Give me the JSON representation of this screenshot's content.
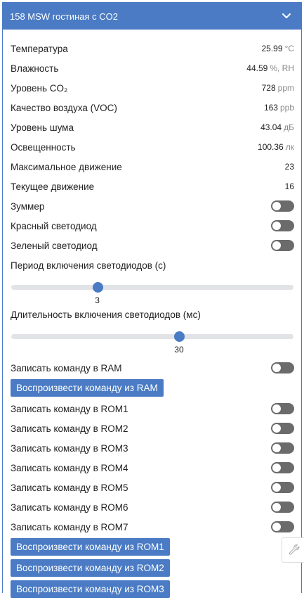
{
  "header": {
    "title": "158 MSW гостиная с CO2"
  },
  "sensors": [
    {
      "label": "Температура",
      "value": "25.99",
      "unit": "°C"
    },
    {
      "label": "Влажность",
      "value": "44.59",
      "unit": "%, RH"
    },
    {
      "label": "Уровень CO₂",
      "value": "728",
      "unit": "ppm"
    },
    {
      "label": "Качество воздуха (VOC)",
      "value": "163",
      "unit": "ppb"
    },
    {
      "label": "Уровень шума",
      "value": "43.04",
      "unit": "дБ"
    },
    {
      "label": "Освещенность",
      "value": "100.36",
      "unit": "лк"
    },
    {
      "label": "Максимальное движение",
      "value": "23",
      "unit": ""
    },
    {
      "label": "Текущее движение",
      "value": "16",
      "unit": ""
    }
  ],
  "switches": [
    {
      "label": "Зуммер",
      "on": false
    },
    {
      "label": "Красный светодиод",
      "on": false
    },
    {
      "label": "Зеленый светодиод",
      "on": false
    }
  ],
  "sliders": [
    {
      "label": "Период включения светодиодов (с)",
      "value": "3",
      "fraction": 0.306
    },
    {
      "label": "Длительность включения светодиодов (мс)",
      "value": "30",
      "fraction": 0.594
    }
  ],
  "ram": {
    "write_label": "Записать команду в RAM",
    "play_label": "Воспроизвести команду из RAM"
  },
  "rom_writes": [
    "Записать команду в ROM1",
    "Записать команду в ROM2",
    "Записать команду в ROM3",
    "Записать команду в ROM4",
    "Записать команду в ROM5",
    "Записать команду в ROM6",
    "Записать команду в ROM7"
  ],
  "rom_plays": [
    "Воспроизвести команду из ROM1",
    "Воспроизвести команду из ROM2",
    "Воспроизвести команду из ROM3"
  ],
  "colors": {
    "accent": "#4a7bc4",
    "toggle_off": "#6b6b6b",
    "track": "#e1e3e6"
  },
  "icons": {
    "collapse": "chevron-down-icon",
    "settings": "wrench-icon"
  }
}
